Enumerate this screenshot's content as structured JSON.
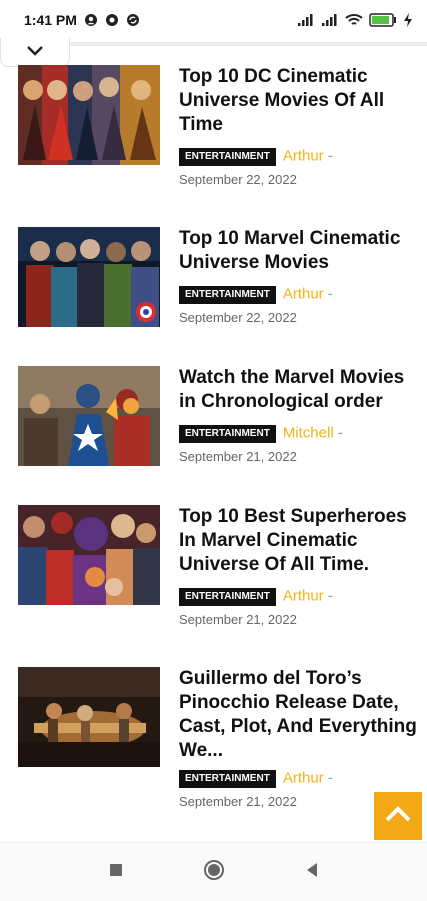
{
  "status_bar": {
    "time": "1:41 PM",
    "battery": "83"
  },
  "collapse": {
    "icon": "chevron-down-icon"
  },
  "articles": [
    {
      "title": "Top 10 DC Cinematic Universe Movies Of All Time",
      "category": "ENTERTAINMENT",
      "author": "Arthur",
      "date": "September 22, 2022",
      "image_colors": [
        "#3a2523",
        "#c43524",
        "#4f4966",
        "#d98e2a"
      ]
    },
    {
      "title": "Top 10 Marvel Cinematic Universe Movies",
      "category": "ENTERTAINMENT",
      "author": "Arthur",
      "date": "September 22, 2022",
      "image_colors": [
        "#101a2b",
        "#2c6387",
        "#7d2d20",
        "#41662c"
      ]
    },
    {
      "title": "Watch the Marvel Movies in Chronological order",
      "category": "ENTERTAINMENT",
      "author": "Mitchell",
      "date": "September 21, 2022",
      "image_colors": [
        "#6f5c48",
        "#2a4e79",
        "#a93222",
        "#e8a233"
      ]
    },
    {
      "title": "Top 10 Best Superheroes In Marvel Cinematic Universe Of All Time.",
      "category": "ENTERTAINMENT",
      "author": "Arthur",
      "date": "September 21, 2022",
      "image_colors": [
        "#2a2526",
        "#b82a27",
        "#513675",
        "#d0a36d"
      ]
    },
    {
      "title": "Guillermo del Toro’s Pinocchio Release Date, Cast, Plot, And Everything We...",
      "category": "ENTERTAINMENT",
      "author": "Arthur",
      "date": "September 21, 2022",
      "image_colors": [
        "#2d1f18",
        "#8f6038",
        "#d6aa65",
        "#4d3423"
      ]
    }
  ],
  "back_to_top": {
    "icon": "chevron-up-icon"
  },
  "navigation": {
    "recent": "square-icon",
    "home": "circle-icon",
    "back": "back-triangle-icon"
  },
  "colors": {
    "accent": "#f3a816",
    "author": "#f4b315",
    "category_bg": "#111111"
  }
}
